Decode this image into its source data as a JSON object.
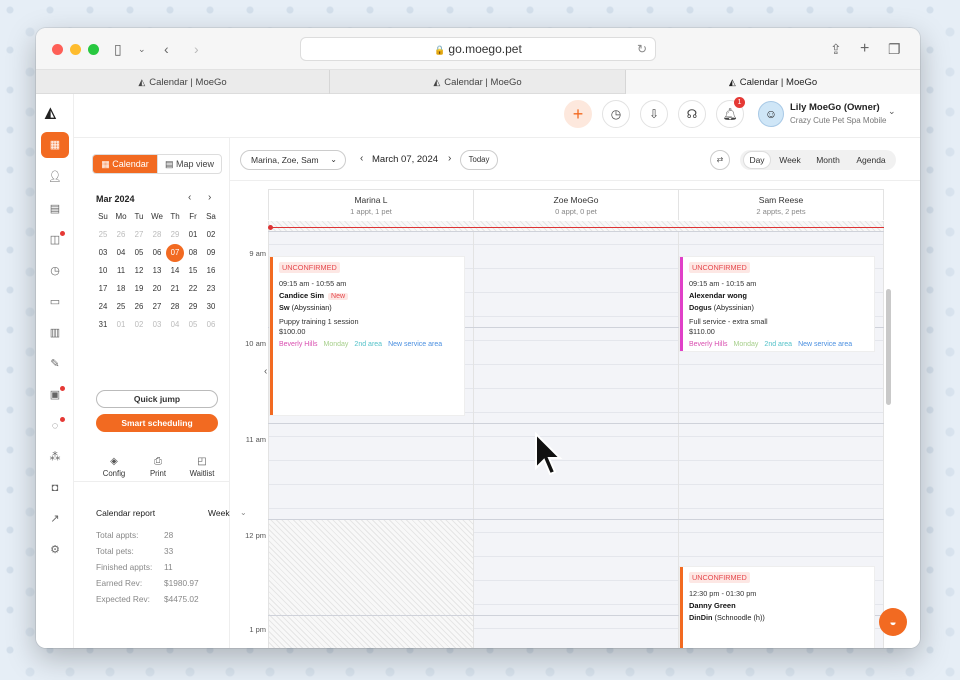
{
  "browser": {
    "url": "go.moego.pet",
    "tabs": [
      "Calendar | MoeGo",
      "Calendar | MoeGo",
      "Calendar | MoeGo"
    ],
    "active_tab": 2
  },
  "header": {
    "user_name": "Lily MoeGo (Owner)",
    "business": "Crazy Cute Pet Spa Mobile",
    "notification_count": "1"
  },
  "sidebar_nav": [
    "calendar-icon",
    "clients-icon",
    "bookings-icon",
    "messages-icon",
    "reminders-icon",
    "payments-icon",
    "reports-icon",
    "marketing-icon",
    "retail-icon",
    "chat-icon",
    "team-icon",
    "shop-icon",
    "insights-icon",
    "settings-icon"
  ],
  "view_toggle": {
    "calendar": "Calendar",
    "map": "Map view"
  },
  "mini_calendar": {
    "month": "Mar 2024",
    "weekdays": [
      "Su",
      "Mo",
      "Tu",
      "We",
      "Th",
      "Fr",
      "Sa"
    ],
    "weeks": [
      [
        "25",
        "26",
        "27",
        "28",
        "29",
        "01",
        "02"
      ],
      [
        "03",
        "04",
        "05",
        "06",
        "07",
        "08",
        "09"
      ],
      [
        "10",
        "11",
        "12",
        "13",
        "14",
        "15",
        "16"
      ],
      [
        "17",
        "18",
        "19",
        "20",
        "21",
        "22",
        "23"
      ],
      [
        "24",
        "25",
        "26",
        "27",
        "28",
        "29",
        "30"
      ],
      [
        "31",
        "01",
        "02",
        "03",
        "04",
        "05",
        "06"
      ]
    ],
    "selected": "07"
  },
  "buttons": {
    "quick_jump": "Quick jump",
    "smart_scheduling": "Smart scheduling",
    "config": "Config",
    "print": "Print",
    "waitlist": "Waitlist",
    "today": "Today"
  },
  "report": {
    "title": "Calendar report",
    "period": "Week",
    "stats": [
      {
        "label": "Total appts:",
        "value": "28"
      },
      {
        "label": "Total pets:",
        "value": "33"
      },
      {
        "label": "Finished appts:",
        "value": "11"
      },
      {
        "label": "Earned Rev:",
        "value": "$1980.97"
      },
      {
        "label": "Expected Rev:",
        "value": "$4475.02"
      }
    ]
  },
  "controls": {
    "staff_filter": "Marina, Zoe, Sam",
    "date": "March 07, 2024",
    "views": [
      "Day",
      "Week",
      "Month",
      "Agenda"
    ],
    "active_view": "Day"
  },
  "time_labels": [
    "9 am",
    "10 am",
    "11 am",
    "12 pm",
    "1 pm"
  ],
  "staff_columns": [
    {
      "name": "Marina L",
      "summary": "1 appt, 1 pet"
    },
    {
      "name": "Zoe MoeGo",
      "summary": "0 appt, 0 pet"
    },
    {
      "name": "Sam Reese",
      "summary": "2 appts, 2 pets"
    }
  ],
  "appointments": [
    {
      "status": "UNCONFIRMED",
      "time": "09:15 am - 10:55 am",
      "client": "Candice Sim",
      "new_tag": "New",
      "pet": "Sw",
      "breed": "(Abyssinian)",
      "service": "Puppy training 1 session",
      "price": "$100.00",
      "tags": [
        "Beverly Hills",
        "Monday",
        "2nd area",
        "New service area"
      ],
      "color": "#f26a21"
    },
    {
      "status": "UNCONFIRMED",
      "time": "09:15 am - 10:15 am",
      "client": "Alexendar wong",
      "pet": "Dogus",
      "breed": "(Abyssinian)",
      "service": "Full service - extra small",
      "price": "$110.00",
      "tags": [
        "Beverly Hills",
        "Monday",
        "2nd area",
        "New service area"
      ],
      "color": "#e040c8"
    },
    {
      "status": "UNCONFIRMED",
      "time": "12:30 pm - 01:30 pm",
      "client": "Danny Green",
      "pet": "DinDin",
      "breed": "(Schnoodle (h))",
      "color": "#f26a21"
    }
  ],
  "colors": {
    "brand": "#f26a21",
    "tag1": "#d94fb0",
    "tag2": "#a6cf8a",
    "tag3": "#52c1c8",
    "tag4": "#4a8fe0"
  }
}
